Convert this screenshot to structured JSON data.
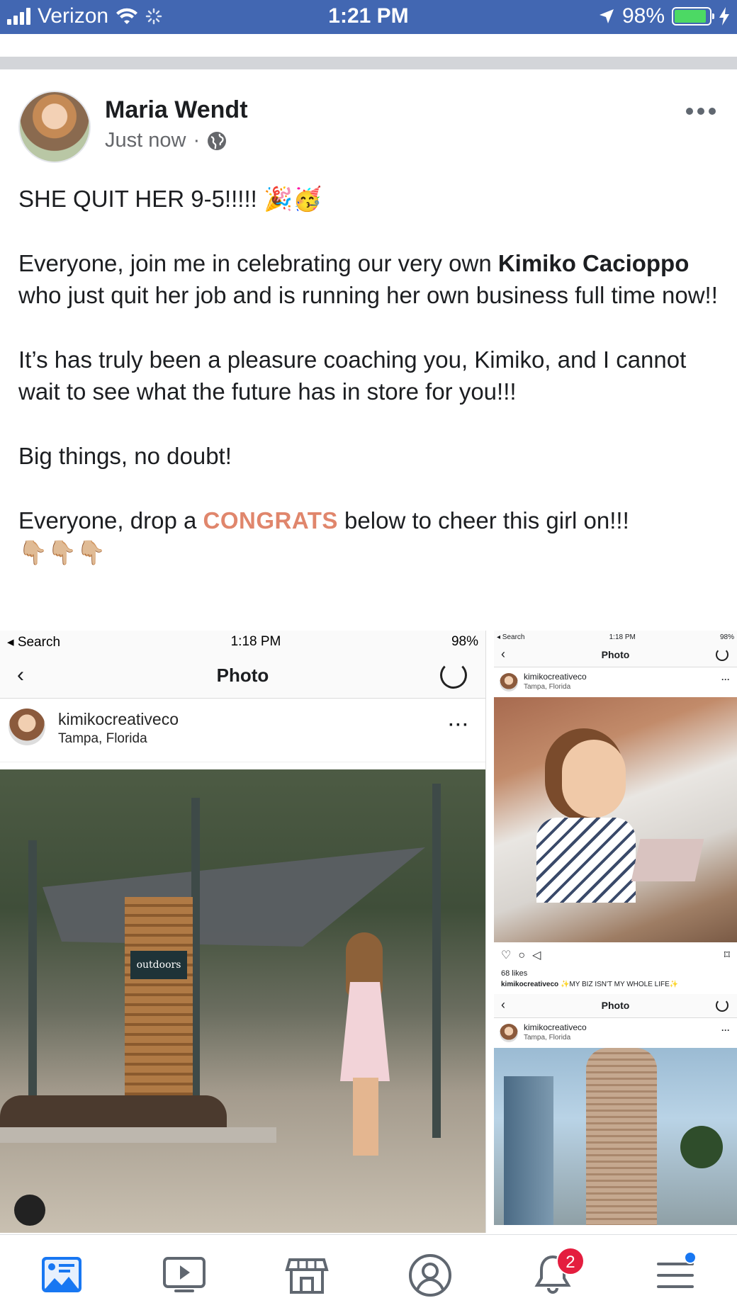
{
  "status_bar": {
    "carrier": "Verizon",
    "time": "1:21 PM",
    "battery": "98%"
  },
  "post": {
    "author": "Maria Wendt",
    "timestamp": "Just now",
    "separator": "·",
    "privacy_icon": "globe-icon",
    "line1": "SHE QUIT HER 9-5!!!!! 🎉🥳",
    "p2_a": "Everyone, join me in celebrating our very own ",
    "p2_name": "Kimiko Cacioppo",
    "p2_b": " who just quit her job and is running her own business full time now!!",
    "p3": "It’s has truly been a pleasure coaching you, Kimiko, and I cannot wait to see what the future has in store for you!!!",
    "p4": "Big things, no doubt!",
    "p5_a": "Everyone, drop a ",
    "p5_highlight": "CONGRATS",
    "p5_b": " below to cheer this girl on!!!",
    "emoji_row": "👇🏼👇🏼👇🏼",
    "accent_color": "#e0866c"
  },
  "photo_main": {
    "status_left": "◂ Search",
    "status_time": "1:18 PM",
    "status_battery": "98%",
    "nav_title": "Photo",
    "username": "kimikocreativeco",
    "location": "Tampa, Florida",
    "sign_text": "outdoors"
  },
  "photo_side": {
    "status_left": "◂ Search",
    "status_time": "1:18 PM",
    "status_battery": "98%",
    "nav_title": "Photo",
    "username": "kimikocreativeco",
    "location": "Tampa, Florida",
    "likes": "68 likes",
    "caption_user": "kimikocreativeco",
    "caption_text": " ✨MY BIZ ISN'T MY WHOLE LIFE✨",
    "nav_title_2": "Photo",
    "username_2": "kimikocreativeco",
    "location_2": "Tampa, Florida"
  },
  "tabbar": {
    "notifications_badge": "2",
    "items": [
      "news-feed-icon",
      "watch-icon",
      "marketplace-icon",
      "profile-icon",
      "notifications-icon",
      "menu-icon"
    ],
    "active_color": "#1877f2"
  }
}
